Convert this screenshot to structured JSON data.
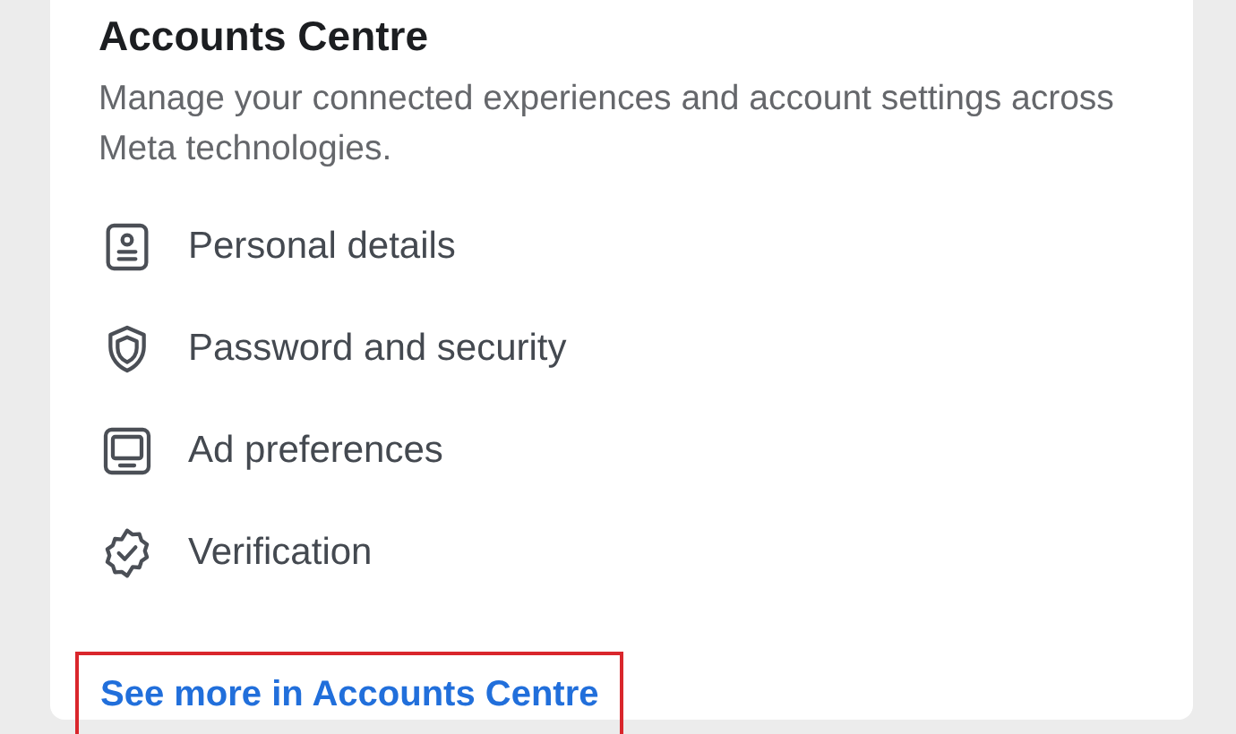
{
  "card": {
    "title": "Accounts Centre",
    "description": "Manage your connected experiences and account settings across Meta technologies.",
    "items": [
      {
        "kind": "id",
        "label": "Personal details"
      },
      {
        "kind": "shield",
        "label": "Password and security"
      },
      {
        "kind": "monitor",
        "label": "Ad preferences"
      },
      {
        "kind": "badge",
        "label": "Verification"
      }
    ],
    "link": {
      "label": "See more in Accounts Centre",
      "highlighted": true
    }
  }
}
